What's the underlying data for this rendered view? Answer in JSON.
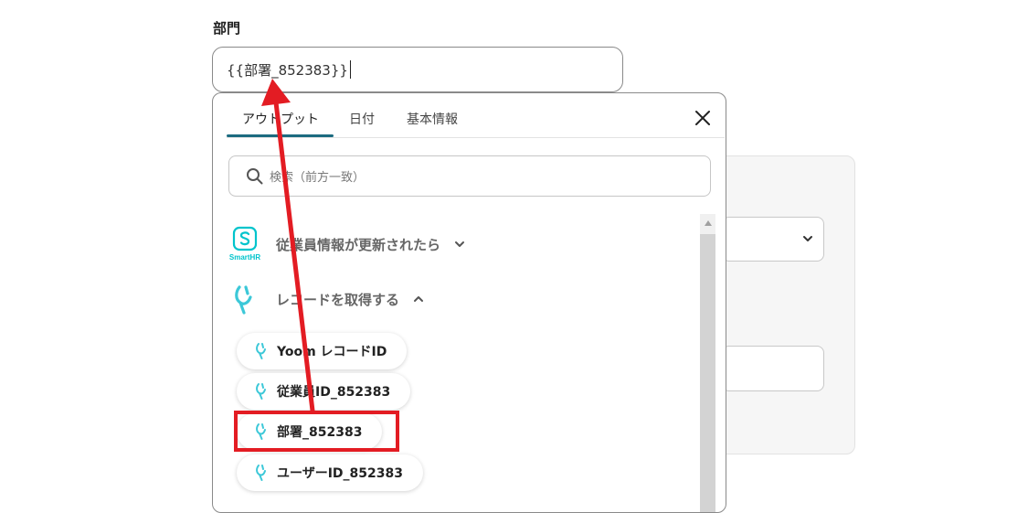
{
  "field": {
    "label": "部門",
    "value": "{{部署_852383}}"
  },
  "popup": {
    "tabs": [
      {
        "label": "アウトプット",
        "active": true
      },
      {
        "label": "日付",
        "active": false
      },
      {
        "label": "基本情報",
        "active": false
      }
    ],
    "search_placeholder": "検索（前方一致）",
    "sections": [
      {
        "title": "従業員情報が更新されたら",
        "icon": "smarthr-logo",
        "logo_text": "SmartHR",
        "expanded": false
      },
      {
        "title": "レコードを取得する",
        "icon": "yoom-logo",
        "expanded": true
      }
    ],
    "items": [
      {
        "label": "Yoom レコードID"
      },
      {
        "label": "従業員ID_852383"
      },
      {
        "label": "部署_852383",
        "highlighted": true
      },
      {
        "label": "ユーザーID_852383"
      }
    ]
  },
  "colors": {
    "accent_tab": "#1c6b80",
    "highlight_red": "#e31c23",
    "smarthr_teal": "#00c4cc",
    "yoom_teal": "#3cc8d8"
  }
}
